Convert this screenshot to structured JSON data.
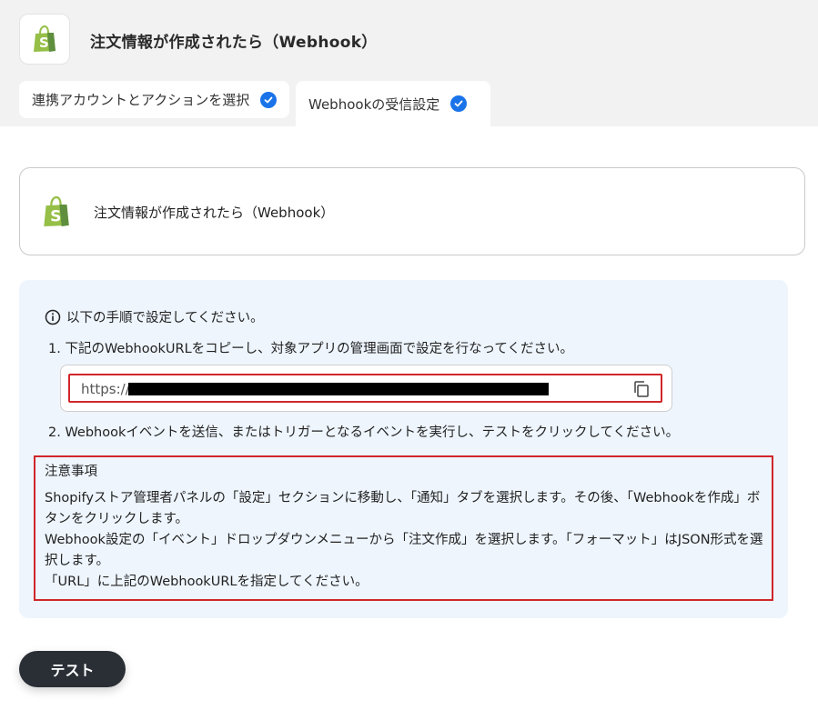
{
  "header": {
    "title": "注文情報が作成されたら（Webhook）",
    "app_icon": "shopify-bag-icon"
  },
  "tabs": [
    {
      "label": "連携アカウントとアクションを選択",
      "completed": true
    },
    {
      "label": "Webhookの受信設定",
      "completed": true,
      "active": true
    }
  ],
  "trigger_card": {
    "label": "注文情報が作成されたら（Webhook）",
    "icon": "shopify-bag-icon"
  },
  "instructions": {
    "intro": "以下の手順で設定してください。",
    "step1": "1. 下記のWebhookURLをコピーし、対象アプリの管理画面で設定を行なってください。",
    "url_prefix": "https://",
    "step2": "2. Webhookイベントを送信、またはトリガーとなるイベントを実行し、テストをクリックしてください。"
  },
  "notes": {
    "title": "注意事項",
    "line1": "Shopifyストア管理者パネルの「設定」セクションに移動し、「通知」タブを選択します。その後、「Webhookを作成」ボタンをクリックします。",
    "line2": "Webhook設定の「イベント」ドロップダウンメニューから「注文作成」を選択します。「フォーマット」はJSON形式を選択します。",
    "line3": "「URL」に上記のWebhookURLを指定してください。"
  },
  "actions": {
    "test_label": "テスト"
  },
  "colors": {
    "accent": "#1a73e8",
    "shopify_green": "#95bf47",
    "highlight_red": "#d0262a",
    "panel_bg": "#eef5fd",
    "button_dark": "#2a2f36"
  }
}
